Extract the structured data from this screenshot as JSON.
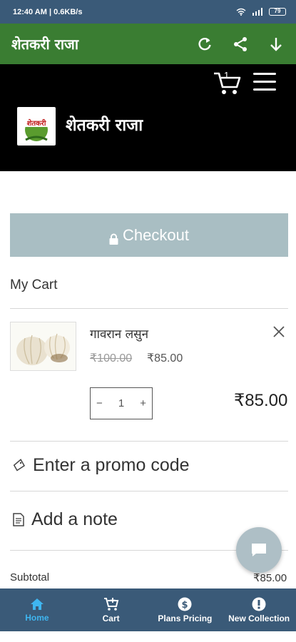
{
  "status": {
    "left": "12:40 AM | 0.6KB/s",
    "battery": "79"
  },
  "appbar": {
    "title": "शेतकरी राजा",
    "icons": [
      "refresh-icon",
      "share-icon",
      "download-icon"
    ]
  },
  "site": {
    "name": "शेतकरी राजा",
    "cart_count": "1",
    "logo_text": "शेतकरी"
  },
  "checkout": {
    "label": "Checkout"
  },
  "cart": {
    "heading": "My Cart",
    "item": {
      "name": "गावरान लसुन",
      "old_price": "₹100.00",
      "price": "₹85.00",
      "quantity": "1",
      "line_total": "₹85.00"
    }
  },
  "promo": {
    "label": "Enter a promo code"
  },
  "note": {
    "label": "Add a note"
  },
  "summary": {
    "subtotal_label": "Subtotal",
    "subtotal_value": "₹85.00"
  },
  "bottom_nav": {
    "items": [
      {
        "label": "Home",
        "icon": "home-icon"
      },
      {
        "label": "Cart",
        "icon": "cart-icon"
      },
      {
        "label": "Plans Pricing",
        "icon": "dollar-icon"
      },
      {
        "label": "New Collection",
        "icon": "info-icon"
      }
    ]
  },
  "colors": {
    "status_bar": "#3a5a78",
    "app_bar": "#3a7d32",
    "checkout_button": "#a9bec3",
    "nav_active": "#3fb6f0"
  }
}
